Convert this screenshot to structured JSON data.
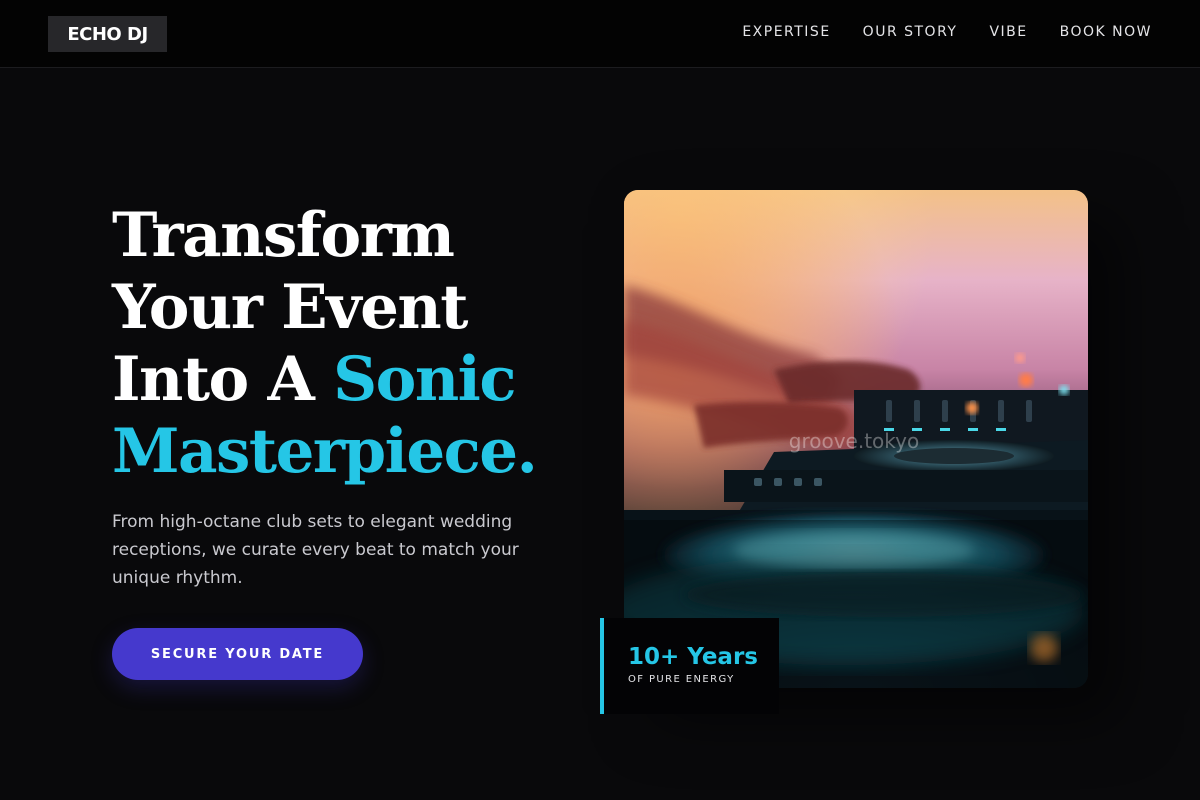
{
  "brand": {
    "logo_text": "ECHO DJ"
  },
  "nav": {
    "links": [
      {
        "label": "EXPERTISE"
      },
      {
        "label": "OUR STORY"
      },
      {
        "label": "VIBE"
      },
      {
        "label": "BOOK NOW"
      }
    ]
  },
  "hero": {
    "headline": {
      "line1": "Transform",
      "line2": "Your Event",
      "line3_plain": "Into A",
      "line3_accent": "Sonic",
      "line4_accent": "Masterpiece."
    },
    "subhead": "From high-octane club sets to elegant wedding receptions, we curate every beat to match your unique rhythm.",
    "cta_label": "SECURE YOUR DATE",
    "image": {
      "watermark": "groove.tokyo"
    },
    "stat": {
      "value": "10+ Years",
      "label": "OF PURE ENERGY"
    }
  },
  "colors": {
    "background": "#09090b",
    "navbar": "#030303",
    "accent": "#25c6e6",
    "cta": "#4539cd",
    "text": "#ffffff",
    "muted": "#c9c9cf"
  }
}
